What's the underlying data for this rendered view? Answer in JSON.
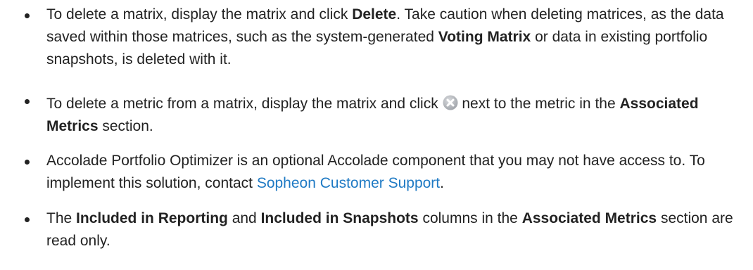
{
  "bullets": {
    "delete_matrix": {
      "t1": "To delete a matrix, display the matrix and click ",
      "b1": "Delete",
      "t2": ". Take caution when deleting matrices, as the data saved within those matrices, such as the system-generated ",
      "b2": "Voting Matrix",
      "t3": " or data in existing portfolio snapshots, is deleted with it."
    },
    "delete_metric": {
      "t1": "To delete a metric from a matrix, display the matrix and click ",
      "icon": "delete-icon",
      "t2": " next to the metric in the ",
      "b1": "Associated Metrics",
      "t3": " section."
    },
    "optimizer": {
      "t1": "Accolade Portfolio Optimizer is an optional Accolade component that you may not have access to. To implement this solution, contact ",
      "link": "Sopheon Customer Support",
      "t2": "."
    },
    "read_only": {
      "t1": "The ",
      "b1": "Included in Reporting",
      "t2": " and ",
      "b2": "Included in Snapshots",
      "t3": " columns in the ",
      "b3": "Associated Metrics",
      "t4": " section are read only."
    }
  },
  "colors": {
    "text": "#222222",
    "link": "#1f7ac4",
    "icon": "#b5b8bd"
  }
}
